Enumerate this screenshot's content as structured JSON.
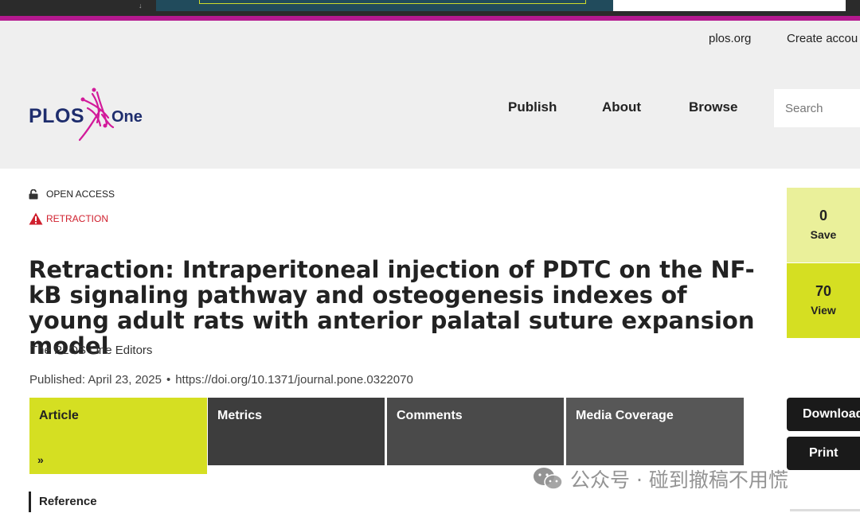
{
  "header": {
    "util_links": {
      "plos": "plos.org",
      "create": "Create accou"
    },
    "logo": {
      "word": "PLOS",
      "sub": "One"
    },
    "nav": [
      "Publish",
      "About",
      "Browse"
    ],
    "search": {
      "placeholder": "Search"
    }
  },
  "article": {
    "access": "OPEN ACCESS",
    "retraction": "RETRACTION",
    "title": "Retraction: Intraperitoneal injection of PDTC on the NF-kB signaling pathway and osteogenesis indexes of young adult rats with anterior palatal suture expansion model",
    "author": "The PLOS One Editors",
    "published": "Published: April 23, 2025",
    "doi": "https://doi.org/10.1371/journal.pone.0322070"
  },
  "tabs": [
    "Article",
    "Metrics",
    "Comments",
    "Media Coverage"
  ],
  "sidebar_item": "Reference",
  "metrics": {
    "save": {
      "value": "0",
      "label": "Save"
    },
    "view": {
      "value": "70",
      "label": "View"
    }
  },
  "actions": {
    "download": "Download",
    "print": "Print"
  },
  "watermark": "公众号 · 碰到撤稿不用慌",
  "colors": {
    "accent": "#d5df22",
    "brand": "#b4198f",
    "retraction": "#d0202e"
  }
}
